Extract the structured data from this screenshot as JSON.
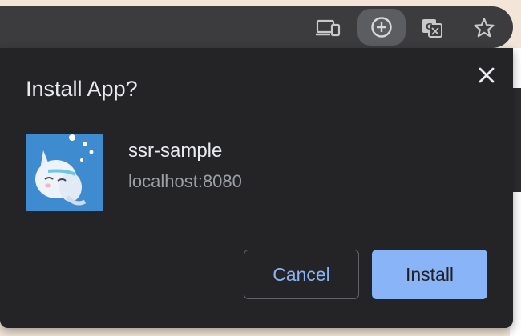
{
  "toolbar": {
    "icons": [
      "devices-icon",
      "install-app-icon",
      "translate-icon",
      "star-icon"
    ]
  },
  "dialog": {
    "title": "Install App?",
    "close_icon": "close-icon",
    "app": {
      "name": "ssr-sample",
      "origin": "localhost:8080"
    },
    "cancel_label": "Cancel",
    "install_label": "Install"
  },
  "colors": {
    "dialog_bg": "#242427",
    "accent": "#8ab4f8",
    "text": "#e8eaed",
    "secondary_text": "#9aa0a6"
  }
}
